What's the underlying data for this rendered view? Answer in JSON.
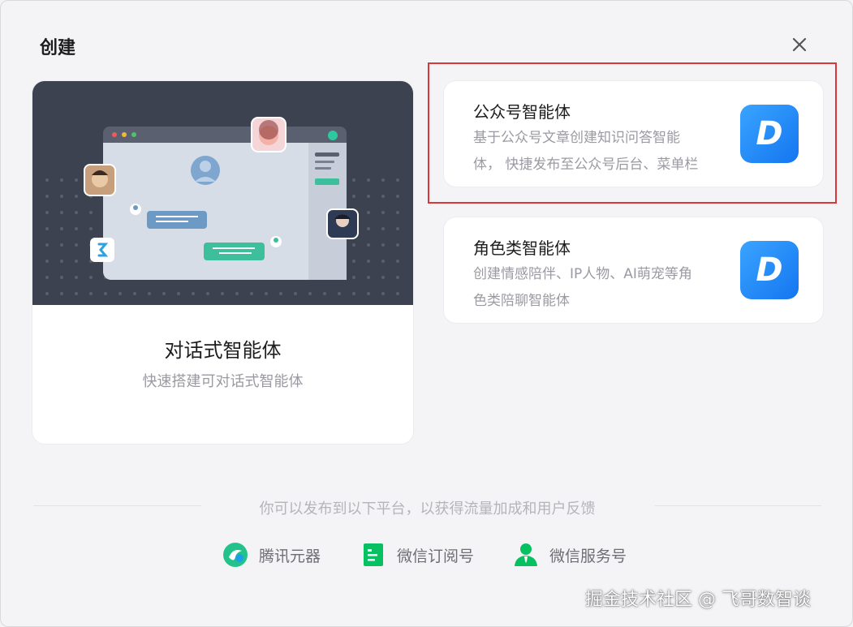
{
  "dialog": {
    "title": "创建"
  },
  "main_card": {
    "title": "对话式智能体",
    "subtitle": "快速搭建可对话式智能体"
  },
  "cards": [
    {
      "title": "公众号智能体",
      "desc_line1": "基于公众号文章创建知识问答智能",
      "desc_line2": "体， 快捷发布至公众号后台、菜单栏",
      "logo_letter": "D"
    },
    {
      "title": "角色类智能体",
      "desc_line1": "创建情感陪伴、IP人物、AI萌宠等角",
      "desc_line2": "色类陪聊智能体",
      "logo_letter": "D"
    }
  ],
  "footer": {
    "note": "你可以发布到以下平台，以获得流量加成和用户反馈",
    "platforms": [
      {
        "label": "腾讯元器",
        "icon": "yuanqi-logo-icon"
      },
      {
        "label": "微信订阅号",
        "icon": "subscription-account-icon"
      },
      {
        "label": "微信服务号",
        "icon": "service-account-icon"
      }
    ]
  },
  "watermark": "掘金技术社区 @ 飞哥数智谈",
  "colors": {
    "accent_blue": "#1476f0",
    "highlight_red": "#d9373a",
    "wechat_green": "#07c160",
    "illustration_bg": "#3d4250"
  }
}
